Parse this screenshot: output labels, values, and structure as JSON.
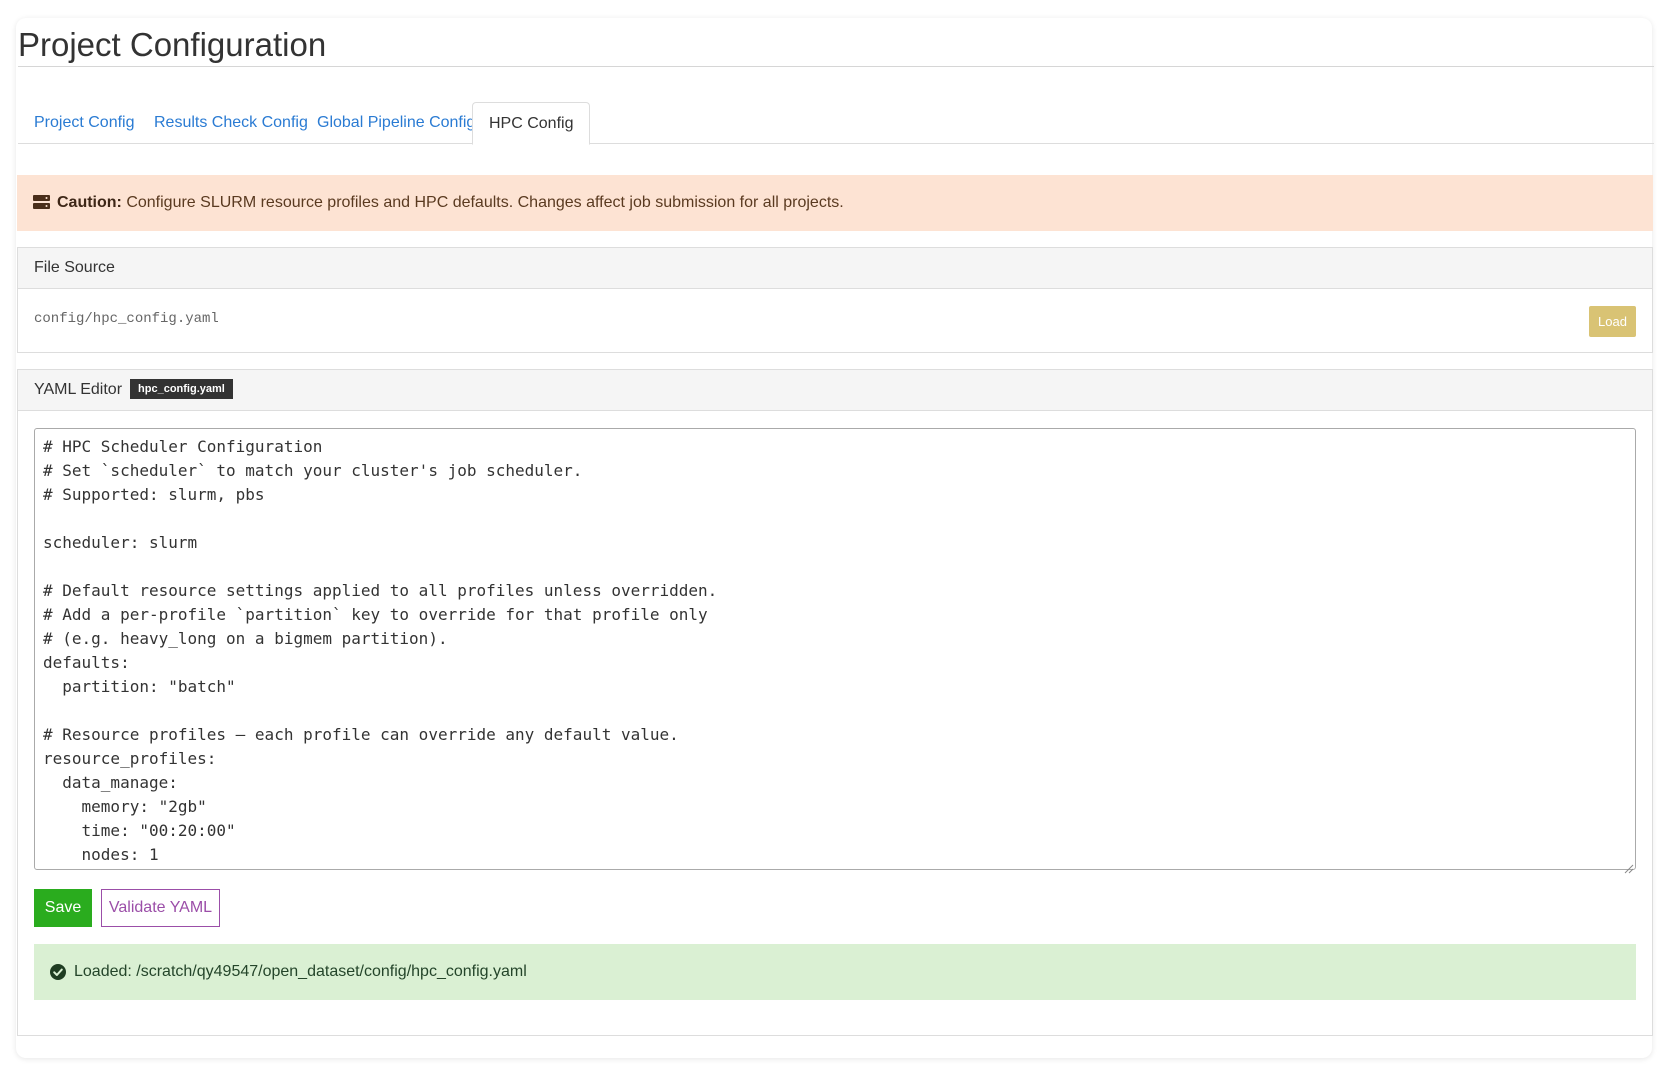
{
  "page": {
    "title": "Project Configuration"
  },
  "tabs": [
    {
      "label": "Project Config",
      "active": false
    },
    {
      "label": "Results Check Config",
      "active": false
    },
    {
      "label": "Global Pipeline Config",
      "active": false
    },
    {
      "label": "HPC Config",
      "active": true
    }
  ],
  "caution": {
    "icon": "server-icon",
    "label": "Caution:",
    "message": "Configure SLURM resource profiles and HPC defaults. Changes affect job submission for all projects."
  },
  "file_source": {
    "heading": "File Source",
    "path": "config/hpc_config.yaml",
    "load_label": "Load"
  },
  "yaml_editor": {
    "heading": "YAML Editor",
    "badge": "hpc_config.yaml",
    "content": "# HPC Scheduler Configuration\n# Set `scheduler` to match your cluster's job scheduler.\n# Supported: slurm, pbs\n\nscheduler: slurm\n\n# Default resource settings applied to all profiles unless overridden.\n# Add a per-profile `partition` key to override for that profile only\n# (e.g. heavy_long on a bigmem partition).\ndefaults:\n  partition: \"batch\"\n\n# Resource profiles — each profile can override any default value.\nresource_profiles:\n  data_manage:\n    memory: \"2gb\"\n    time: \"00:20:00\"\n    nodes: 1",
    "save_label": "Save",
    "validate_label": "Validate YAML"
  },
  "status": {
    "icon": "check-circle-icon",
    "message": "Loaded: /scratch/qy49547/open_dataset/config/hpc_config.yaml"
  },
  "colors": {
    "link": "#2a7bd3",
    "caution_bg": "#fde3d3",
    "success_bg": "#daf0d3",
    "save_button": "#2aac1e",
    "validate_button": "#9b4ea8",
    "load_button": "#d9c374"
  }
}
